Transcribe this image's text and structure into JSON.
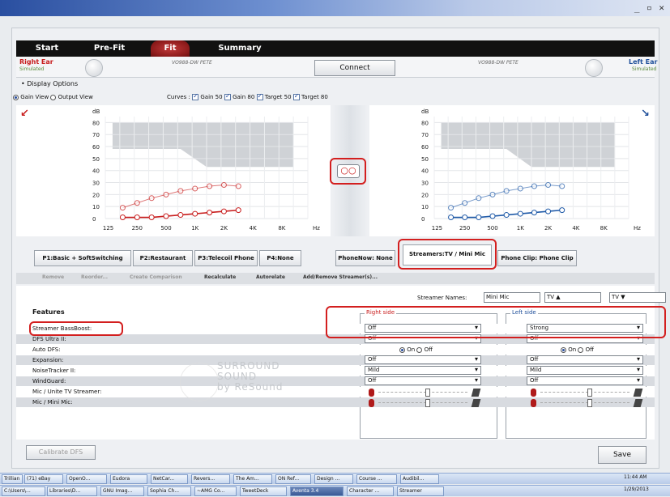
{
  "window": {
    "controls": "_ ▫ ✕"
  },
  "nav": {
    "tabs": [
      "Start",
      "Pre-Fit",
      "Fit",
      "Summary"
    ]
  },
  "ears": {
    "right_label": "Right Ear",
    "right_sub": "Simulated",
    "left_label": "Left Ear",
    "left_sub": "Simulated",
    "right_device": "VO988-DW PETE",
    "left_device": "VO988-DW PETE"
  },
  "connect_label": "Connect",
  "display_options": "Display Options",
  "view": {
    "gain": "Gain View",
    "output": "Output View"
  },
  "curves": {
    "label": "Curves :",
    "gain50": "Gain 50",
    "gain80": "Gain 80",
    "target50": "Target 50",
    "target80": "Target 80"
  },
  "chart_data": [
    {
      "type": "line",
      "ylabel": "dB",
      "xlabel": "Hz",
      "categories": [
        "125",
        "250",
        "500",
        "1K",
        "2K",
        "4K",
        "8K"
      ],
      "y_ticks": [
        "80",
        "70",
        "60",
        "50",
        "40",
        "30",
        "20",
        "10",
        "0"
      ],
      "ylim": [
        0,
        85
      ],
      "series": [
        {
          "values": [
            null,
            9,
            13,
            17,
            20,
            23,
            25,
            27,
            28,
            27
          ]
        },
        {
          "values": [
            null,
            1,
            1,
            1,
            2,
            3,
            4,
            5,
            6,
            7
          ]
        }
      ]
    },
    {
      "type": "line",
      "ylabel": "dB",
      "xlabel": "Hz",
      "categories": [
        "125",
        "250",
        "500",
        "1K",
        "2K",
        "4K",
        "8K"
      ],
      "y_ticks": [
        "80",
        "70",
        "60",
        "50",
        "40",
        "30",
        "20",
        "10",
        "0"
      ],
      "ylim": [
        0,
        85
      ],
      "series": [
        {
          "values": [
            null,
            9,
            13,
            17,
            20,
            23,
            25,
            27,
            28,
            27
          ]
        },
        {
          "values": [
            null,
            1,
            1,
            1,
            2,
            3,
            4,
            5,
            6,
            7
          ]
        }
      ]
    }
  ],
  "program_tabs": [
    "P1:Basic + SoftSwitching",
    "P2:Restaurant",
    "P3:Telecoil Phone",
    "P4:None"
  ],
  "stream_tabs": [
    "PhoneNow: None",
    "Streamers:TV / Mini Mic",
    "Phone Clip: Phone Clip"
  ],
  "actions": [
    "Remove",
    "Reorder...",
    "Create Comparison",
    "Recalculate",
    "Autorelate",
    "Add/Remove Streamer(s)..."
  ],
  "streamer_names": {
    "label": "Streamer Names:",
    "values": [
      "Mini Mic",
      "TV ▲",
      "TV ▼"
    ]
  },
  "features": {
    "header": "Features",
    "right_header": "Right side",
    "left_header": "Left side",
    "rows": [
      {
        "label": "Streamer BassBoost:",
        "right": "Off",
        "left": "Strong",
        "kind": "dd"
      },
      {
        "label": "DFS Ultra II:",
        "right": "Off",
        "left": "Off",
        "kind": "dd"
      },
      {
        "label": "Auto DFS:",
        "right": "On",
        "left": "On",
        "kind": "radio",
        "off": "Off"
      },
      {
        "label": "Expansion:",
        "right": "Off",
        "left": "Off",
        "kind": "dd"
      },
      {
        "label": "NoiseTracker II:",
        "right": "Mild",
        "left": "Mild",
        "kind": "dd"
      },
      {
        "label": "WindGuard:",
        "right": "Off",
        "left": "Off",
        "kind": "dd"
      },
      {
        "label": "Mic / Unite TV Streamer:",
        "kind": "slider"
      },
      {
        "label": "Mic / Mini Mic:",
        "kind": "slider"
      }
    ]
  },
  "watermark": {
    "line1": "SURROUND",
    "line2": "SOUND",
    "line3": "by ReSound"
  },
  "buttons": {
    "calibrate": "Calibrate DFS",
    "save": "Save"
  },
  "taskbar1": [
    "Trillian",
    "(71) eBay",
    "OpenO...",
    "Eudora",
    "NetCar...",
    "Revers...",
    "The Am...",
    "ON Ref...",
    "Design ...",
    "Course ...",
    "Audibil..."
  ],
  "taskbar2": [
    "C:\\Users\\...",
    "Libraries\\D...",
    "GNU Imag...",
    "Sophia Ch...",
    "~AMG Co...",
    "TweetDeck",
    "Aventa 3.4",
    "Character ...",
    "Streamer"
  ],
  "clock": {
    "time": "11:44 AM",
    "date": "1/29/2013"
  }
}
